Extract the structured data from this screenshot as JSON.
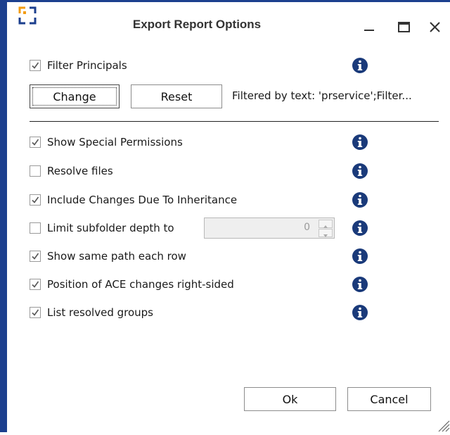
{
  "window": {
    "title": "Export Report Options",
    "icon": "app-logo-icon",
    "controls": [
      "minimize-icon",
      "maximize-icon",
      "close-icon"
    ],
    "accent_color": "#1c3f8e",
    "info_color": "#1a3a7a"
  },
  "filter": {
    "label": "Filter Principals",
    "checked": true,
    "change_label": "Change",
    "reset_label": "Reset",
    "status_text": "Filtered by text: 'prservice';Filter..."
  },
  "options": [
    {
      "label": "Show Special Permissions",
      "checked": true
    },
    {
      "label": "Resolve files",
      "checked": false
    },
    {
      "label": "Include Changes Due To Inheritance",
      "checked": true
    },
    {
      "label": "Limit subfolder depth to",
      "checked": false
    },
    {
      "label": "Show same path each row",
      "checked": true
    },
    {
      "label": "Position of ACE changes right-sided",
      "checked": true
    },
    {
      "label": "List resolved groups",
      "checked": true
    }
  ],
  "depth": {
    "value": "0"
  },
  "footer": {
    "ok_label": "Ok",
    "cancel_label": "Cancel"
  }
}
